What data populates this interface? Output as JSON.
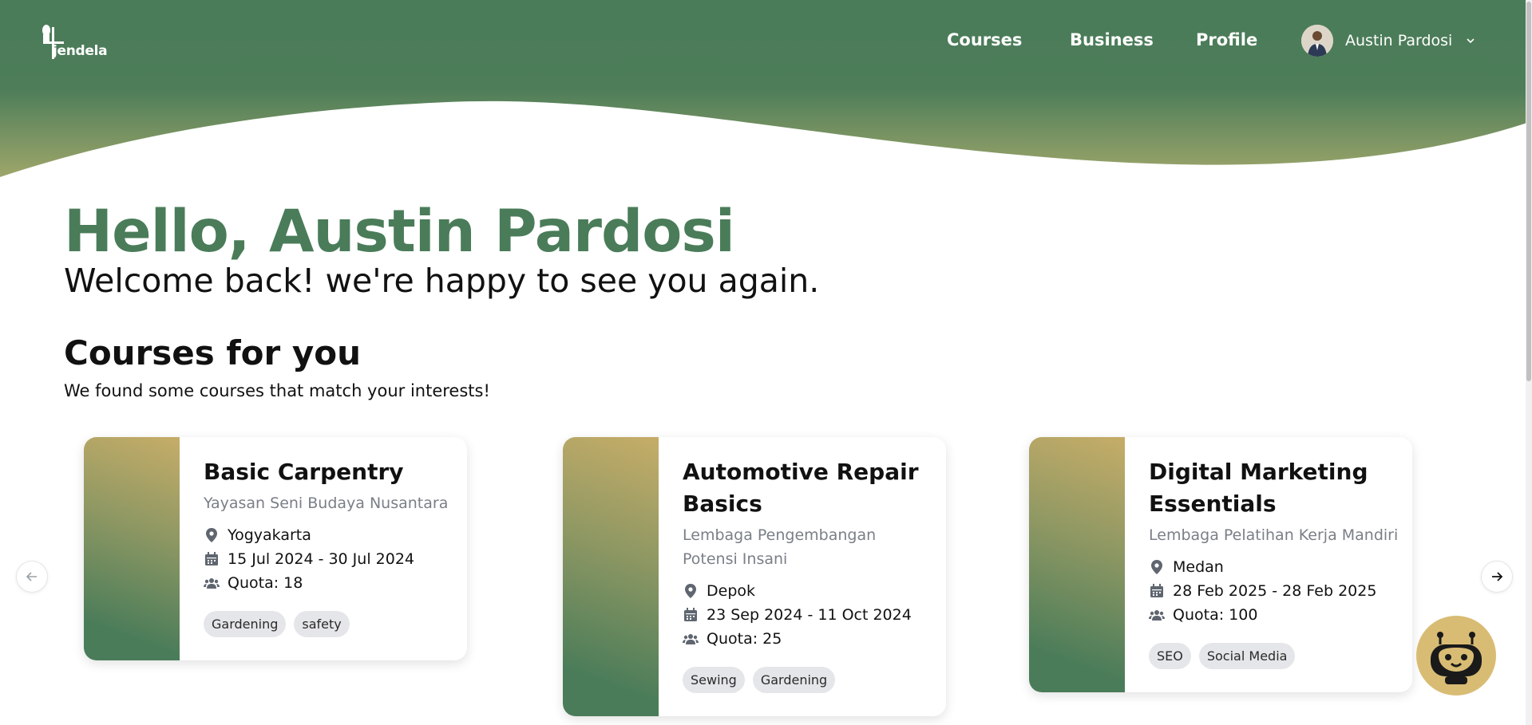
{
  "header": {
    "logo_text": "jendela",
    "nav": [
      {
        "label": "Courses"
      },
      {
        "label": "Business"
      },
      {
        "label": "Profile"
      }
    ],
    "user": {
      "name": "Austin Pardosi"
    },
    "colors": {
      "primary": "#4a7c59",
      "gold": "#c6ad68"
    }
  },
  "hero": {
    "greeting": "Hello, Austin Pardosi",
    "welcome": "Welcome back! we're happy to see you again."
  },
  "section": {
    "title": "Courses for you",
    "subtitle": "We found some courses that match your interests!"
  },
  "courses": [
    {
      "title": "Basic Carpentry",
      "org": "Yayasan Seni Budaya Nusantara",
      "location": "Yogyakarta",
      "dates": "15 Jul 2024 - 30 Jul 2024",
      "quota": "Quota: 18",
      "tags": [
        "Gardening",
        "safety"
      ]
    },
    {
      "title": "Automotive Repair Basics",
      "org": "Lembaga Pengembangan Potensi Insani",
      "location": "Depok",
      "dates": "23 Sep 2024 - 11 Oct 2024",
      "quota": "Quota: 25",
      "tags": [
        "Sewing",
        "Gardening"
      ]
    },
    {
      "title": "Digital Marketing Essentials",
      "org": "Lembaga Pelatihan Kerja Mandiri",
      "location": "Medan",
      "dates": "28 Feb 2025 - 28 Feb 2025",
      "quota": "Quota: 100",
      "tags": [
        "SEO",
        "Social Media"
      ]
    }
  ],
  "icons": {
    "location": "map-pin-icon",
    "date": "calendar-icon",
    "quota": "users-icon",
    "prev": "arrow-left-icon",
    "next": "arrow-right-icon",
    "assistant": "robot-icon"
  }
}
